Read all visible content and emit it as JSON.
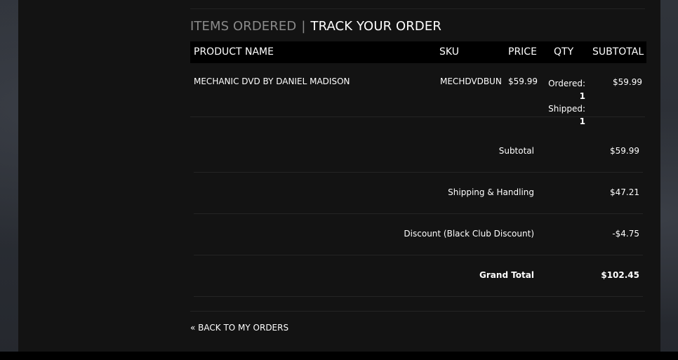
{
  "tabs": {
    "items_ordered": "ITEMS ORDERED",
    "separator": "|",
    "track_order": "TRACK YOUR ORDER"
  },
  "table": {
    "headers": [
      "PRODUCT NAME",
      "SKU",
      "PRICE",
      "QTY",
      "SUBTOTAL"
    ],
    "rows": [
      {
        "product_name": "MECHANIC DVD BY DANIEL MADISON",
        "sku": "MECHDVDBUN",
        "price": "$59.99",
        "ordered_label": "Ordered:",
        "ordered_qty": "1",
        "shipped_label": "Shipped:",
        "shipped_qty": "1",
        "subtotal": "$59.99"
      }
    ]
  },
  "totals": [
    {
      "label": "Subtotal",
      "value": "$59.99"
    },
    {
      "label": "Shipping & Handling",
      "value": "$47.21"
    },
    {
      "label": "Discount (Black Club Discount)",
      "value": "-$4.75"
    },
    {
      "label": "Grand Total",
      "value": "$102.45"
    }
  ],
  "back_link": "« BACK TO MY ORDERS"
}
